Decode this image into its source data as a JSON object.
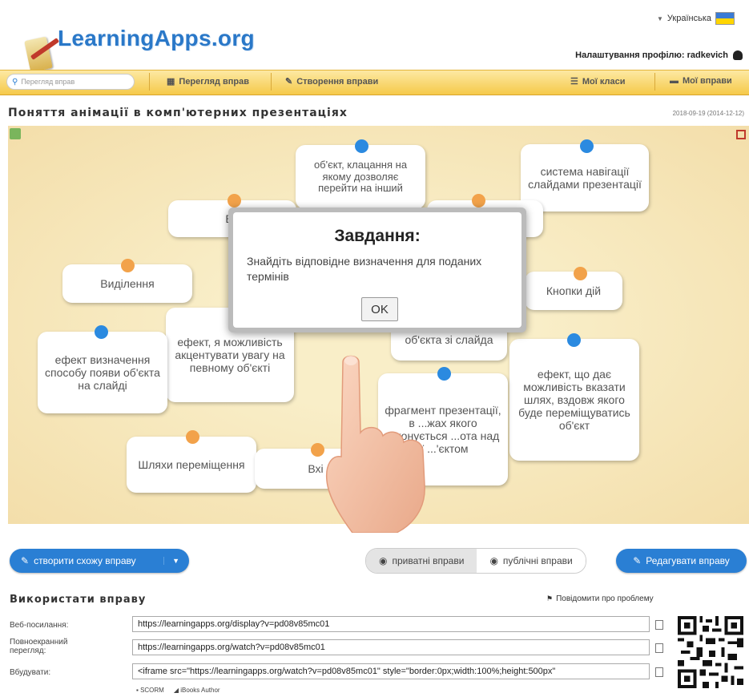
{
  "header": {
    "logo_text": "LearningApps.org",
    "language": "Українська",
    "profile_text": "Налаштування профілю: radkevich"
  },
  "nav": {
    "search_placeholder": "Перегляд вправ",
    "items": [
      {
        "label": "Перегляд вправ",
        "icon": "grid-icon"
      },
      {
        "label": "Створення вправи",
        "icon": "pencil-icon"
      },
      {
        "label": "Мої класи",
        "icon": "list-icon"
      },
      {
        "label": "Мої вправи",
        "icon": "folder-icon"
      }
    ]
  },
  "page": {
    "title": "Поняття анімації в комп'ютерних презентаціях",
    "date": "2018-09-19",
    "date_small": "(2014-12-12)"
  },
  "cards": [
    {
      "text": "об'єкт, клацання на якому дозволяє перейти на інший"
    },
    {
      "text": "система навігації слайдами презентації"
    },
    {
      "text": "Ви"
    },
    {
      "text": "Виділення"
    },
    {
      "text": "Кнопки дій"
    },
    {
      "text": "ефект, я можливість акцентувати увагу на певному об'єкті"
    },
    {
      "text": "об'єкта зі слайда"
    },
    {
      "text": "ефект визначення способу появи об'єкта на слайді"
    },
    {
      "text": "ефект, що дає можливість вказати шлях, вздовж якого буде переміщуватись об'єкт"
    },
    {
      "text": "фрагмент презентації, в ...жах якого ...конується ...ота над її ...'єктом"
    },
    {
      "text": "Шляхи переміщення"
    },
    {
      "text": "Вхі"
    }
  ],
  "modal": {
    "title": "Завдання:",
    "text": "Знайдіть відповідне визначення для поданих термінів",
    "ok_label": "OK"
  },
  "actions": {
    "create_similar": "створити схожу вправу",
    "private": "приватні вправи",
    "public": "публічні вправи",
    "edit": "Редагувати вправу"
  },
  "use": {
    "title": "Використати вправу",
    "report": "Повідомити про проблему",
    "rows": [
      {
        "label": "Веб-посилання:",
        "value": "https://learningapps.org/display?v=pd08v85mc01"
      },
      {
        "label": "Повноекранний перегляд:",
        "value": "https://learningapps.org/watch?v=pd08v85mc01"
      },
      {
        "label": "Вбудувати:",
        "value": "<iframe src=\"https://learningapps.org/watch?v=pd08v85mc01\" style=\"border:0px;width:100%;height:500px\""
      }
    ],
    "scorm": "SCORM",
    "ibooks": "iBooks Author"
  },
  "colors": {
    "accent_blue": "#2a7fd4",
    "nav_yellow": "#f5c94a",
    "board": "#f6e6b4"
  }
}
